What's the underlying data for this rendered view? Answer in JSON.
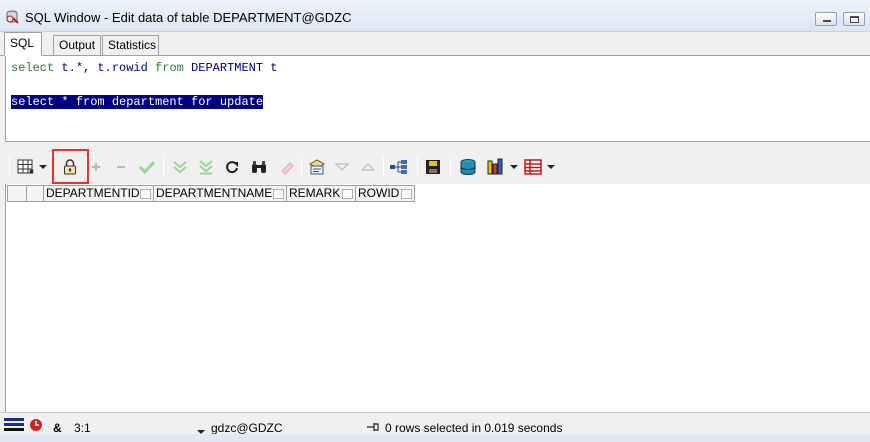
{
  "window": {
    "title": "SQL Window - Edit data of table DEPARTMENT@GDZC",
    "icon": "sql-window-icon"
  },
  "tabs": [
    {
      "label": "SQL",
      "active": true
    },
    {
      "label": "Output",
      "active": false
    },
    {
      "label": "Statistics",
      "active": false
    }
  ],
  "editor": {
    "line1": {
      "select": "select",
      "cols": " t.*, t.rowid ",
      "from": "from",
      "table": " DEPARTMENT t"
    },
    "line2": "",
    "line3": "select * from department for update"
  },
  "toolbar": {
    "items": [
      "grid-view-icon",
      "dropdown-arrow-icon",
      "lock-icon",
      "plus-icon",
      "minus-icon",
      "check-icon",
      "fetch-next-icon",
      "fetch-last-icon",
      "refresh-icon",
      "find-icon",
      "clear-icon",
      "query-by-example-icon",
      "previous-record-icon",
      "next-record-icon",
      "tree-icon",
      "save-icon",
      "export-icon",
      "chart-icon",
      "table-icon"
    ],
    "highlight_color": "#e8302c"
  },
  "grid": {
    "columns": [
      "DEPARTMENTID",
      "DEPARTMENTNAME",
      "REMARK",
      "ROWID"
    ],
    "rows": []
  },
  "status": {
    "position": "3:1",
    "connection": "gdzc@GDZC",
    "message": "0 rows selected in 0.019 seconds",
    "ampersand": "&"
  }
}
